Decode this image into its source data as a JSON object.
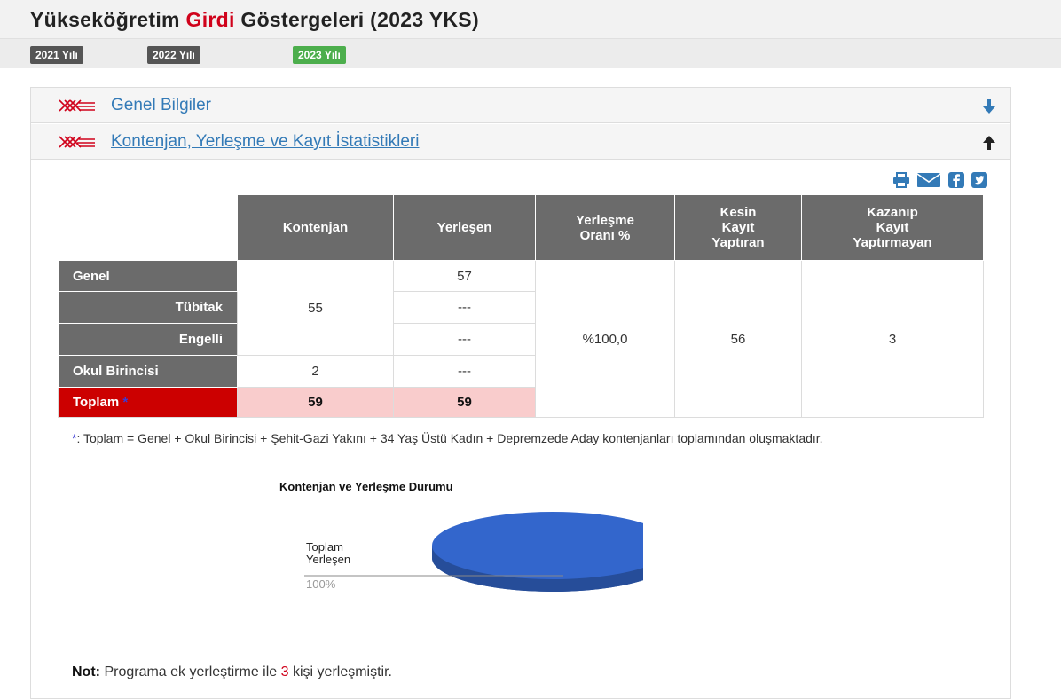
{
  "page": {
    "title_part1": "Yükseköğretim",
    "title_part2": "Girdi",
    "title_part3": "Göstergeleri (2023 YKS)"
  },
  "years": [
    {
      "label": "2021 Yılı",
      "active": false
    },
    {
      "label": "2022 Yılı",
      "active": false
    },
    {
      "label": "2023 Yılı",
      "active": true
    }
  ],
  "sections": {
    "general": {
      "title": "Genel Bilgiler",
      "arrow": "arrow-down-icon"
    },
    "quota": {
      "title": "Kontenjan, Yerleşme ve Kayıt İstatistikleri",
      "arrow": "arrow-up-icon"
    }
  },
  "share_icons": [
    "print-icon",
    "mail-icon",
    "facebook-icon",
    "twitter-icon"
  ],
  "table": {
    "headers": {
      "quota": "Kontenjan",
      "placed": "Yerleşen",
      "rate_l1": "Yerleşme",
      "rate_l2": "Oranı %",
      "final_l1": "Kesin",
      "final_l2": "Kayıt",
      "final_l3": "Yaptıran",
      "notreg_l1": "Kazanıp",
      "notreg_l2": "Kayıt",
      "notreg_l3": "Yaptırmayan"
    },
    "rows": {
      "genel": "Genel",
      "tubitak": "Tübitak",
      "engelli": "Engelli",
      "okul": "Okul Birincisi",
      "toplam": "Toplam",
      "toplam_star": "*"
    },
    "values": {
      "quota_main": "55",
      "quota_okul": "2",
      "quota_total": "59",
      "placed_genel": "57",
      "placed_tubitak": "---",
      "placed_engelli": "---",
      "placed_okul": "---",
      "placed_total": "59",
      "rate": "%100,0",
      "final_reg": "56",
      "not_reg": "3"
    }
  },
  "footnote": {
    "star": "*",
    "text": ": Toplam = Genel + Okul Birincisi + Şehit-Gazi Yakını + 34 Yaş Üstü Kadın + Depremzede Aday kontenjanları toplamından oluşmaktadır."
  },
  "chart_data": {
    "type": "pie",
    "title": "Kontenjan ve Yerleşme Durumu",
    "slices": [
      {
        "label_l1": "Toplam",
        "label_l2": "Yerleşen",
        "value": 100,
        "pct_label": "100%",
        "color": "#3366cc"
      }
    ]
  },
  "note": {
    "prefix": "Not:",
    "text1": "Programa ek yerleştirme ile",
    "count": "3",
    "text2": "kişi yerleşmiştir."
  },
  "colors": {
    "accent_red": "#d0021b",
    "link_blue": "#337ab7",
    "active_green": "#4cae4c",
    "pie_blue": "#3366cc"
  }
}
